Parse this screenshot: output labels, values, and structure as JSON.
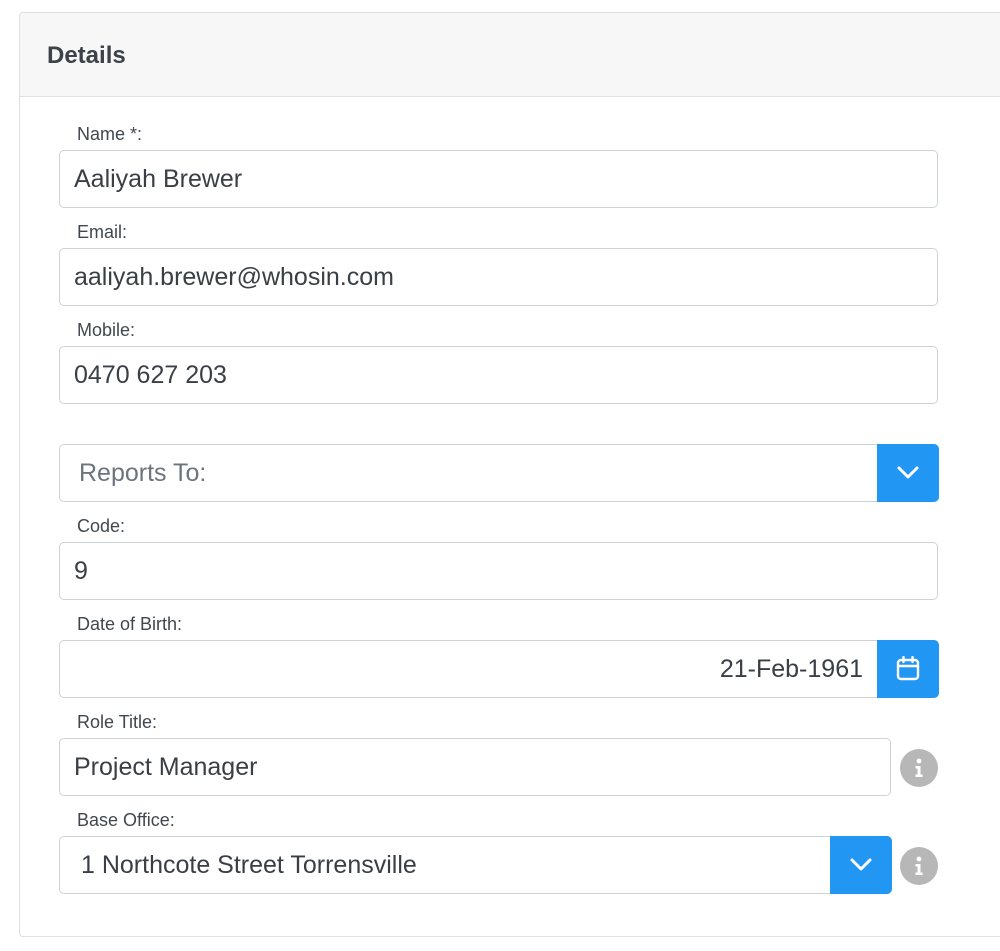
{
  "card": {
    "title": "Details"
  },
  "fields": {
    "name": {
      "label": "Name *:",
      "value": "Aaliyah Brewer"
    },
    "email": {
      "label": "Email:",
      "value": "aaliyah.brewer@whosin.com"
    },
    "mobile": {
      "label": "Mobile:",
      "value": "0470 627 203"
    },
    "reports_to": {
      "placeholder": "Reports To:"
    },
    "code": {
      "label": "Code:",
      "value": "9"
    },
    "dob": {
      "label": "Date of Birth:",
      "value": "21-Feb-1961"
    },
    "role_title": {
      "label": "Role Title:",
      "value": "Project Manager"
    },
    "base_office": {
      "label": "Base Office:",
      "value": "1 Northcote Street Torrensville"
    }
  },
  "colors": {
    "accent": "#2196f3",
    "info_icon": "#b7b7b7",
    "border": "#ced3d8",
    "header_bg": "#f7f7f8"
  },
  "icons": {
    "dropdown": "chevron-down-icon",
    "calendar": "calendar-icon",
    "info": "info-icon"
  }
}
